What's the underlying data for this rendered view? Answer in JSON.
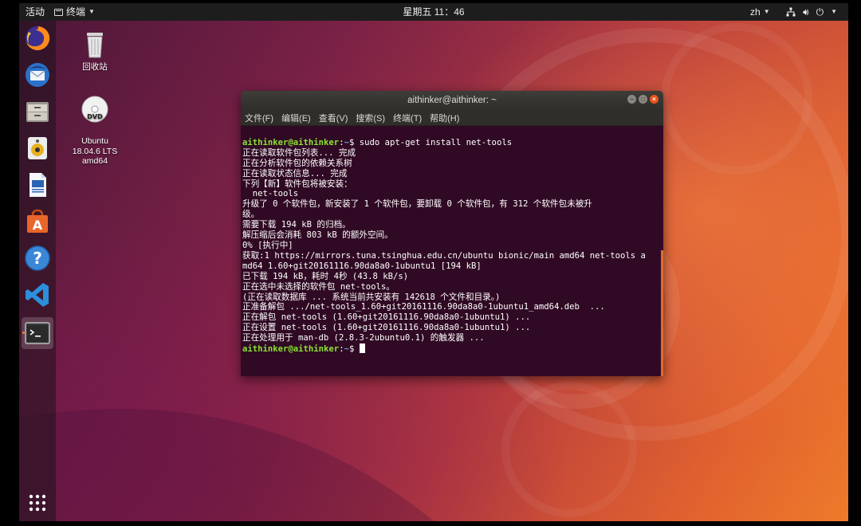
{
  "topbar": {
    "activities": "活动",
    "app_name": "终端",
    "clock": "星期五 11：46",
    "lang": "zh"
  },
  "dock": {
    "items": [
      {
        "name": "firefox-icon"
      },
      {
        "name": "thunderbird-icon"
      },
      {
        "name": "files-icon"
      },
      {
        "name": "rhythmbox-icon"
      },
      {
        "name": "libreoffice-writer-icon"
      },
      {
        "name": "ubuntu-software-icon"
      },
      {
        "name": "help-icon"
      },
      {
        "name": "vscode-icon"
      },
      {
        "name": "terminal-icon"
      },
      {
        "name": "show-apps-icon"
      }
    ]
  },
  "desktop": {
    "trash_label": "回收站",
    "dvd_label": "Ubuntu\n18.04.6 LTS\namd64"
  },
  "terminal": {
    "title": "aithinker@aithinker: ~",
    "menu": [
      "文件(F)",
      "编辑(E)",
      "查看(V)",
      "搜索(S)",
      "终端(T)",
      "帮助(H)"
    ],
    "prompt_user": "aithinker@aithinker",
    "prompt_path": "~",
    "command": "sudo apt-get install net-tools",
    "output": [
      "正在读取软件包列表... 完成",
      "正在分析软件包的依赖关系树",
      "正在读取状态信息... 完成",
      "下列【新】软件包将被安装：",
      "  net-tools",
      "升级了 0 个软件包，新安装了 1 个软件包，要卸载 0 个软件包，有 312 个软件包未被升",
      "级。",
      "需要下载 194 kB 的归档。",
      "解压缩后会消耗 803 kB 的额外空间。",
      "0% [执行中]",
      "获取:1 https://mirrors.tuna.tsinghua.edu.cn/ubuntu bionic/main amd64 net-tools a",
      "md64 1.60+git20161116.90da8a0-1ubuntu1 [194 kB]",
      "已下载 194 kB，耗时 4秒 (43.8 kB/s)",
      "正在选中未选择的软件包 net-tools。",
      "(正在读取数据库 ... 系统当前共安装有 142618 个文件和目录。)",
      "正准备解包 .../net-tools_1.60+git20161116.90da8a0-1ubuntu1_amd64.deb  ...",
      "正在解包 net-tools (1.60+git20161116.90da8a0-1ubuntu1) ...",
      "正在设置 net-tools (1.60+git20161116.90da8a0-1ubuntu1) ...",
      "正在处理用于 man-db (2.8.3-2ubuntu0.1) 的触发器 ..."
    ],
    "colors": {
      "background": "#300a24",
      "prompt_user": "#8ae234",
      "prompt_path": "#729fcf",
      "scrollbar": "#e06a2c"
    }
  }
}
